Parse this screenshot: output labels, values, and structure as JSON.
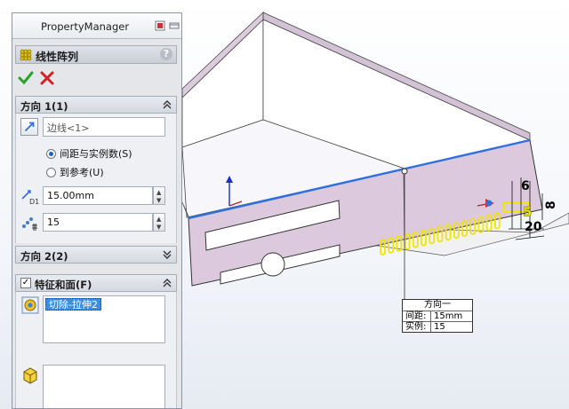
{
  "panel": {
    "title": "PropertyManager",
    "feature_name": "线性阵列",
    "help_label": "?"
  },
  "direction1": {
    "label": "方向 1(1)",
    "edge_value": "边线<1>",
    "option_spacing": "间距与实例数(S)",
    "option_reference": "到参考(U)",
    "selected_option": "option_spacing",
    "spacing_value": "15.00mm",
    "instances_value": "15",
    "spacing_icon_label": "D1"
  },
  "direction2": {
    "label": "方向 2(2)"
  },
  "features": {
    "label": "特征和面(F)",
    "checked_mark": "✓",
    "items": [
      "切除-拉伸2"
    ]
  },
  "model": {
    "callout_title": "方向一",
    "callout_spacing_label": "间距:",
    "callout_spacing_value": "15mm",
    "callout_instances_label": "实例:",
    "callout_instances_value": "15",
    "dim_6": "6",
    "dim_5": "5",
    "dim_20": "20",
    "dim_8": "8",
    "slot_count": 15,
    "face_color": "#dcc9dd",
    "edge_highlight": "#2f6fe0",
    "slot_color": "#f0e400"
  }
}
